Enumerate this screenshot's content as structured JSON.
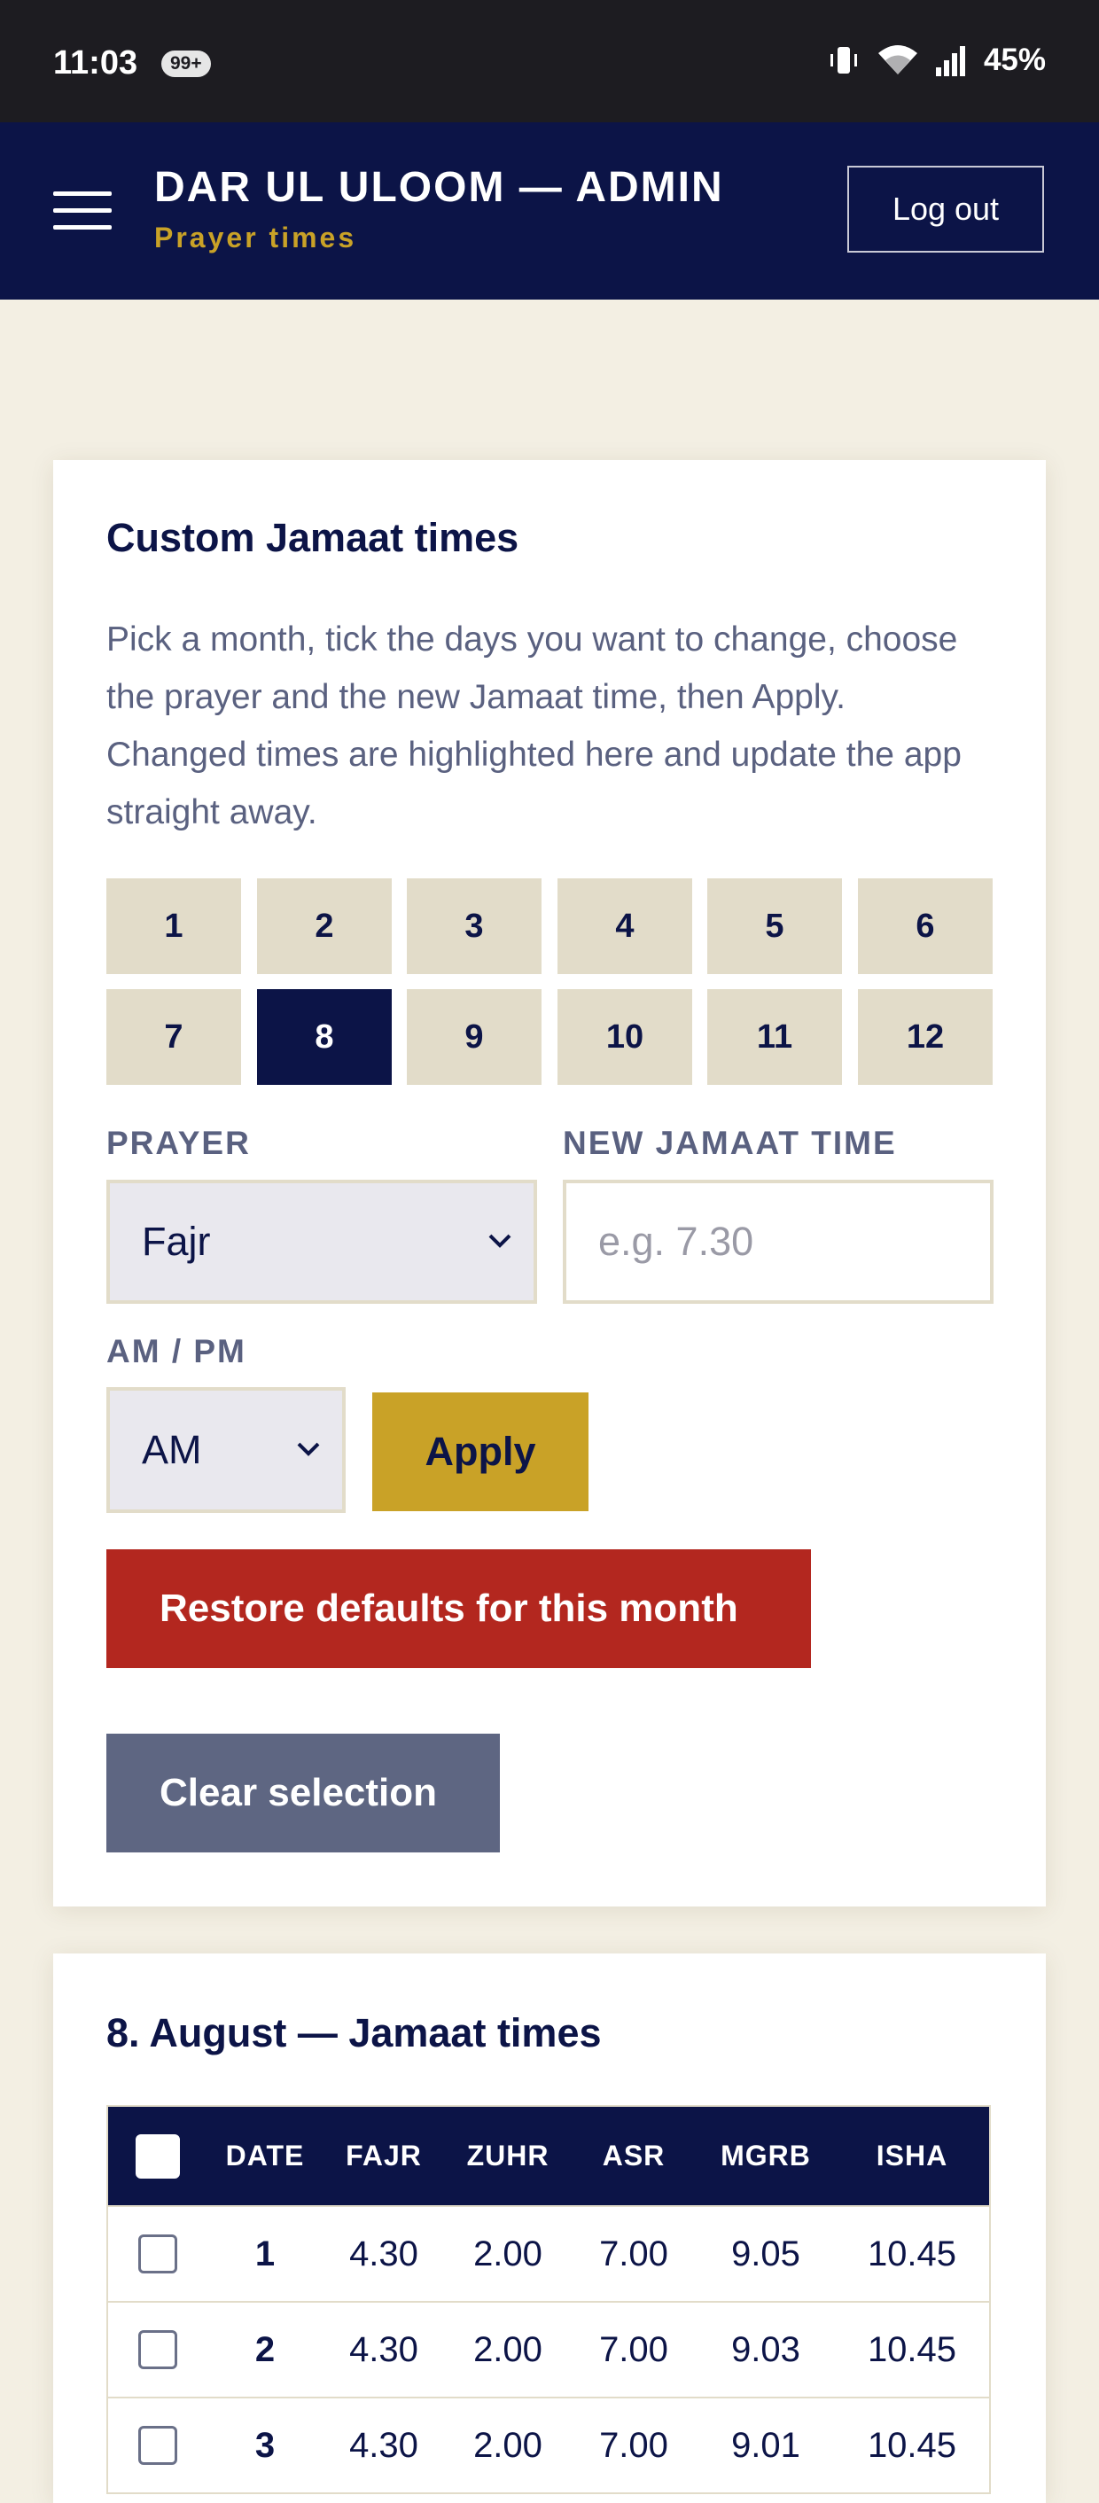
{
  "status_bar": {
    "time": "11:03",
    "badge": "99+",
    "battery": "45%",
    "icons": [
      "vibrate-icon",
      "wifi-icon",
      "signal-icon"
    ]
  },
  "header": {
    "title": "DAR UL ULOOM — ADMIN",
    "subtitle": "Prayer times",
    "logout_label": "Log out",
    "menu_icon": "hamburger-menu-icon"
  },
  "custom": {
    "title": "Custom Jamaat times",
    "description": "Pick a month, tick the days you want to change, choose the prayer and the new Jamaat time, then Apply. Changed times are highlighted here and update the app straight away.",
    "months": [
      "1",
      "2",
      "3",
      "4",
      "5",
      "6",
      "7",
      "8",
      "9",
      "10",
      "11",
      "12"
    ],
    "selected_month": "8",
    "prayer_label": "PRAYER",
    "prayer_value": "Fajr",
    "time_label": "NEW JAMAAT TIME",
    "time_placeholder": "e.g. 7.30",
    "ampm_label": "AM / PM",
    "ampm_value": "AM",
    "apply_label": "Apply",
    "restore_label": "Restore defaults for this month",
    "clear_label": "Clear selection"
  },
  "table": {
    "title": "8. August — Jamaat times",
    "columns": [
      "DATE",
      "FAJR",
      "ZUHR",
      "ASR",
      "MGRB",
      "ISHA"
    ],
    "rows": [
      [
        "1",
        "4.30",
        "2.00",
        "7.00",
        "9.05",
        "10.45"
      ],
      [
        "2",
        "4.30",
        "2.00",
        "7.00",
        "9.03",
        "10.45"
      ],
      [
        "3",
        "4.30",
        "2.00",
        "7.00",
        "9.01",
        "10.45"
      ]
    ]
  },
  "colors": {
    "navy": "#0c1447",
    "gold": "#c9a227",
    "red": "#b3271f",
    "slate": "#5e6682",
    "beige": "#e2dcc9",
    "page_bg": "#f3efe3"
  }
}
